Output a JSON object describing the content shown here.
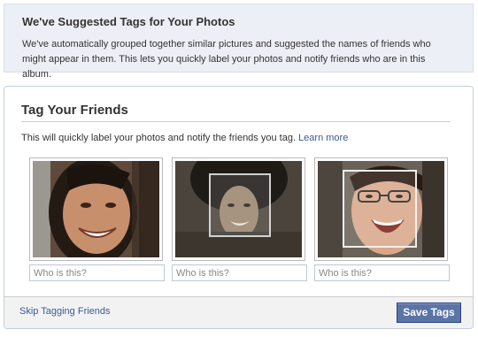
{
  "notice": {
    "title": "We've Suggested Tags for Your Photos",
    "text": "We've automatically grouped together similar pictures and suggested the names of friends who might appear in them. This lets you quickly label your photos and notify friends who are in this album."
  },
  "dialog": {
    "title": "Tag Your Friends",
    "description": "This will quickly label your photos and notify the friends you tag.",
    "learn_more": "Learn more"
  },
  "photos": [
    {
      "input_placeholder": "Who is this?"
    },
    {
      "input_placeholder": "Who is this?"
    },
    {
      "input_placeholder": "Who is this?"
    }
  ],
  "footer": {
    "skip_label": "Skip Tagging Friends",
    "save_label": "Save Tags"
  },
  "colors": {
    "link": "#3b5998",
    "button": "#5b74a8",
    "notice_bg": "#eceff5"
  }
}
